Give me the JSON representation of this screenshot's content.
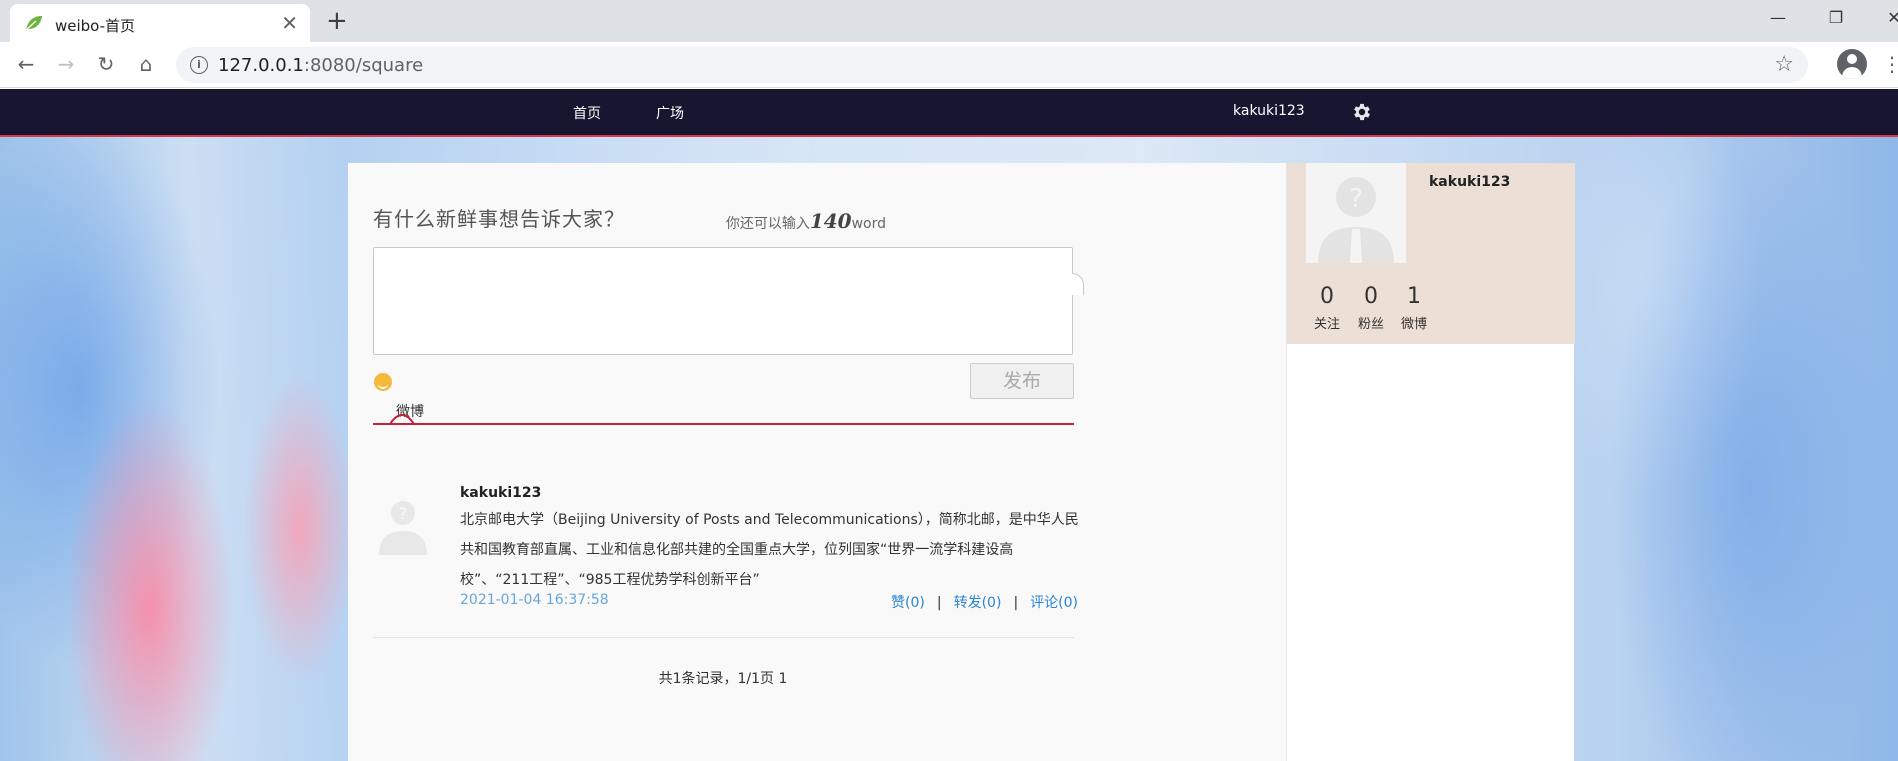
{
  "browser": {
    "tab_title": "weibo-首页",
    "tab_close_glyph": "✕",
    "new_tab_glyph": "+",
    "url_host": "127.0.0.1",
    "url_rest": ":8080/square",
    "window": {
      "minimize": "—",
      "maximize": "❐",
      "close": "✕"
    },
    "icons": {
      "back": "←",
      "forward": "→",
      "reload": "↻",
      "home": "⌂",
      "info": "i",
      "star": "☆",
      "menu": "⋮"
    }
  },
  "site_nav": {
    "home": "首页",
    "square": "广场",
    "username": "kakuki123"
  },
  "composer": {
    "title": "有什么新鲜事想告诉大家？",
    "count_prefix": "你还可以输入",
    "count_value": "140",
    "count_suffix": "word",
    "publish_label": "发布"
  },
  "tabs": {
    "weibo": "微博"
  },
  "post": {
    "username": "kakuki123",
    "text": "北京邮电大学（Beijing University of Posts and Telecommunications），简称北邮，是中华人民共和国教育部直属、工业和信息化部共建的全国重点大学，位列国家“世界一流学科建设高校”、“211工程”、“985工程优势学科创新平台”",
    "time": "2021-01-04 16:37:58",
    "like": "赞(0)",
    "repost": "转发(0)",
    "comment": "评论(0)",
    "separator": "|"
  },
  "pager": {
    "text": "共1条记录，1/1页 1"
  },
  "profile": {
    "name": "kakuki123",
    "follow_count": "0",
    "follow_label": "关注",
    "fans_count": "0",
    "fans_label": "粉丝",
    "weibo_count": "1",
    "weibo_label": "微博"
  },
  "colors": {
    "nav_bg": "#171530",
    "nav_accent": "#d9374a",
    "link": "#2a84d2",
    "timestamp": "#6aa6d8"
  }
}
